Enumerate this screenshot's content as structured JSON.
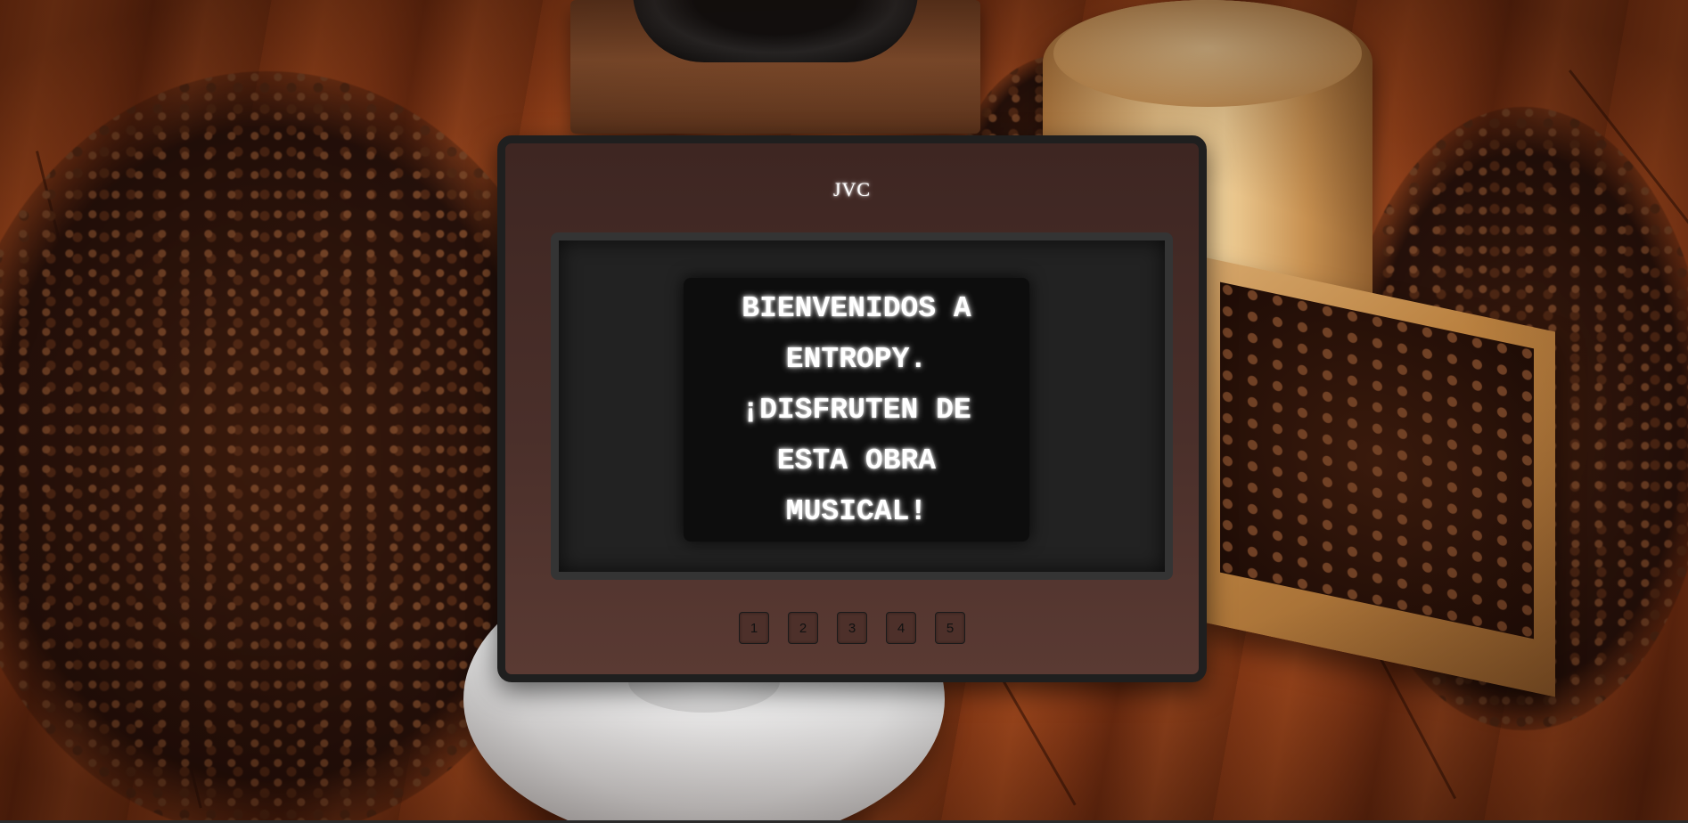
{
  "tv": {
    "brand": "JVC",
    "message": "BIENVENIDOS A ENTROPY. ¡DISFRUTEN DE ESTA OBRA MUSICAL!",
    "channels": [
      "1",
      "2",
      "3",
      "4",
      "5"
    ]
  }
}
